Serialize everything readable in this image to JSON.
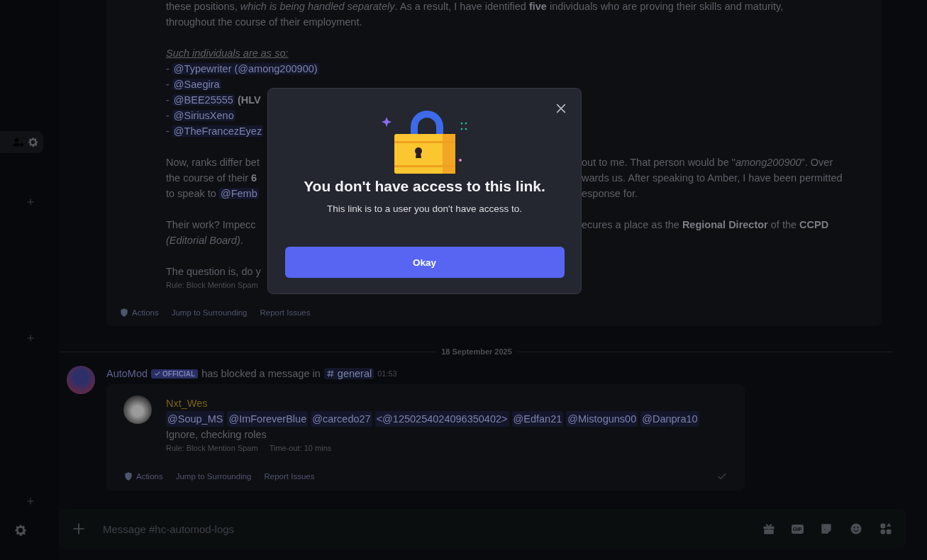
{
  "blocked_message_above": {
    "paragraphs": [
      {
        "lines": [
          {
            "segments": [
              {
                "kind": "text",
                "text": "these positions, *which is being handled separately*. As a result, I have identified **five** individuals who are proving their skills and maturity,"
              }
            ]
          },
          {
            "segments": [
              {
                "kind": "text",
                "text": "throughout the course of their employment."
              }
            ]
          }
        ]
      },
      {
        "lines": [
          {
            "segments": [
              {
                "kind": "heading",
                "text": "Such individuals are as so:"
              }
            ]
          },
          {
            "segments": [
              {
                "kind": "text",
                "text": "- "
              },
              {
                "kind": "mention",
                "text": "@Typewriter (@among200900)"
              }
            ]
          },
          {
            "segments": [
              {
                "kind": "text",
                "text": "- "
              },
              {
                "kind": "mention",
                "text": "@Saegira"
              }
            ]
          },
          {
            "segments": [
              {
                "kind": "text",
                "text": "- "
              },
              {
                "kind": "mention",
                "text": "@BEE25555"
              },
              {
                "kind": "bold",
                "text": "(HLV"
              }
            ]
          },
          {
            "segments": [
              {
                "kind": "text",
                "text": "- "
              },
              {
                "kind": "mention",
                "text": "@SiriusXeno"
              }
            ]
          },
          {
            "segments": [
              {
                "kind": "text",
                "text": "- "
              },
              {
                "kind": "mention",
                "text": "@TheFrancezEyez"
              }
            ]
          }
        ]
      },
      {
        "lines": [
          {
            "segments": [
              {
                "kind": "text",
                "text": "Now, ranks differ bet"
              }
            ],
            "right": "out to me. That person would be \"*among200900*\". Over"
          },
          {
            "segments": [
              {
                "kind": "text",
                "text": "the course of their **6**"
              }
            ],
            "right": "wards us. After speaking to Amber, I have been permitted"
          },
          {
            "segments": [
              {
                "kind": "text",
                "text": "to speak to "
              },
              {
                "kind": "mention",
                "text": "@Femb"
              }
            ],
            "right": "esponse for."
          }
        ]
      },
      {
        "lines": [
          {
            "segments": [
              {
                "kind": "text",
                "text": "Their work? Impecc"
              }
            ],
            "right": "ecures a place as the **Regional Director** of the **CCPD**"
          },
          {
            "segments": [
              {
                "kind": "text",
                "text": "*(Editorial Board)*."
              }
            ]
          }
        ]
      },
      {
        "lines": [
          {
            "segments": [
              {
                "kind": "text",
                "text": "The question is, do y"
              }
            ]
          }
        ]
      }
    ],
    "meta": [
      "Rule: Block Mention Spam"
    ],
    "actions": [
      "Actions",
      "Jump to Surrounding",
      "Report Issues"
    ]
  },
  "date_divider": "18 September 2025",
  "automod_message": {
    "author": "AutoMod",
    "badge": "OFFICIAL",
    "text": "has blocked a message in",
    "channel": "general",
    "time": "01:53",
    "blocked": {
      "author": "Nxt_Wes",
      "mentions": [
        "@Soup_MS",
        "@ImForeverBlue",
        "@carcedo27",
        "<@1250254024096350402>",
        "@Edfan21",
        "@Mistoguns00",
        "@Danpra10"
      ],
      "content": "Ignore, checking roles",
      "meta": [
        "Rule: Block Mention Spam",
        "Time-out: 10 mins"
      ]
    },
    "actions": [
      "Actions",
      "Jump to Surrounding",
      "Report Issues"
    ]
  },
  "composer": {
    "placeholder": "Message #hc-automod-logs",
    "gif": "GIF"
  },
  "modal": {
    "title": "You don't have access to this link.",
    "subtitle": "This link is to a user you don't have access to.",
    "button": "Okay"
  }
}
